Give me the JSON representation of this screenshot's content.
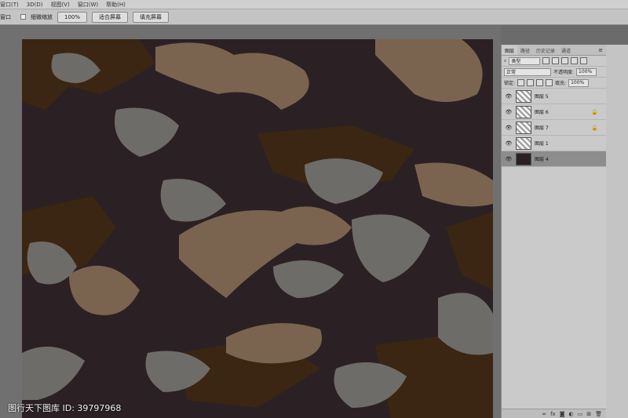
{
  "menubar": {
    "items": [
      "窗口(T)",
      "3D(D)",
      "视图(V)",
      "窗口(W)",
      "帮助(H)"
    ]
  },
  "options": {
    "window_label": "窗口",
    "scrubby_zoom": "细微缩放",
    "zoom_value": "100%",
    "fit_screen": "适合屏幕",
    "fill_screen": "填充屏幕"
  },
  "layers_panel": {
    "tabs": [
      "图层",
      "路径",
      "历史记录",
      "通道"
    ],
    "filter_kind": "类型",
    "blend_mode": "正常",
    "opacity_label": "不透明度:",
    "opacity_value": "100%",
    "lock_label": "锁定:",
    "fill_label": "填充:",
    "fill_value": "100%",
    "layers": [
      {
        "name": "图层 5",
        "locked": false,
        "selected": false
      },
      {
        "name": "图层 6",
        "locked": true,
        "selected": false
      },
      {
        "name": "图层 7",
        "locked": true,
        "selected": false
      },
      {
        "name": "图层 1",
        "locked": false,
        "selected": false
      },
      {
        "name": "图层 4",
        "locked": false,
        "selected": true
      }
    ],
    "footer_icons": [
      "link-icon",
      "fx-icon",
      "mask-icon",
      "adjustment-icon",
      "group-icon",
      "new-layer-icon",
      "trash-icon"
    ]
  },
  "canvas": {
    "colors": {
      "base": "#2b2124",
      "gray": "#6e6c68",
      "brown": "#7a6450",
      "dark_brown": "#3a2612"
    }
  },
  "watermark": "图行天下图库 ID: 39797968"
}
